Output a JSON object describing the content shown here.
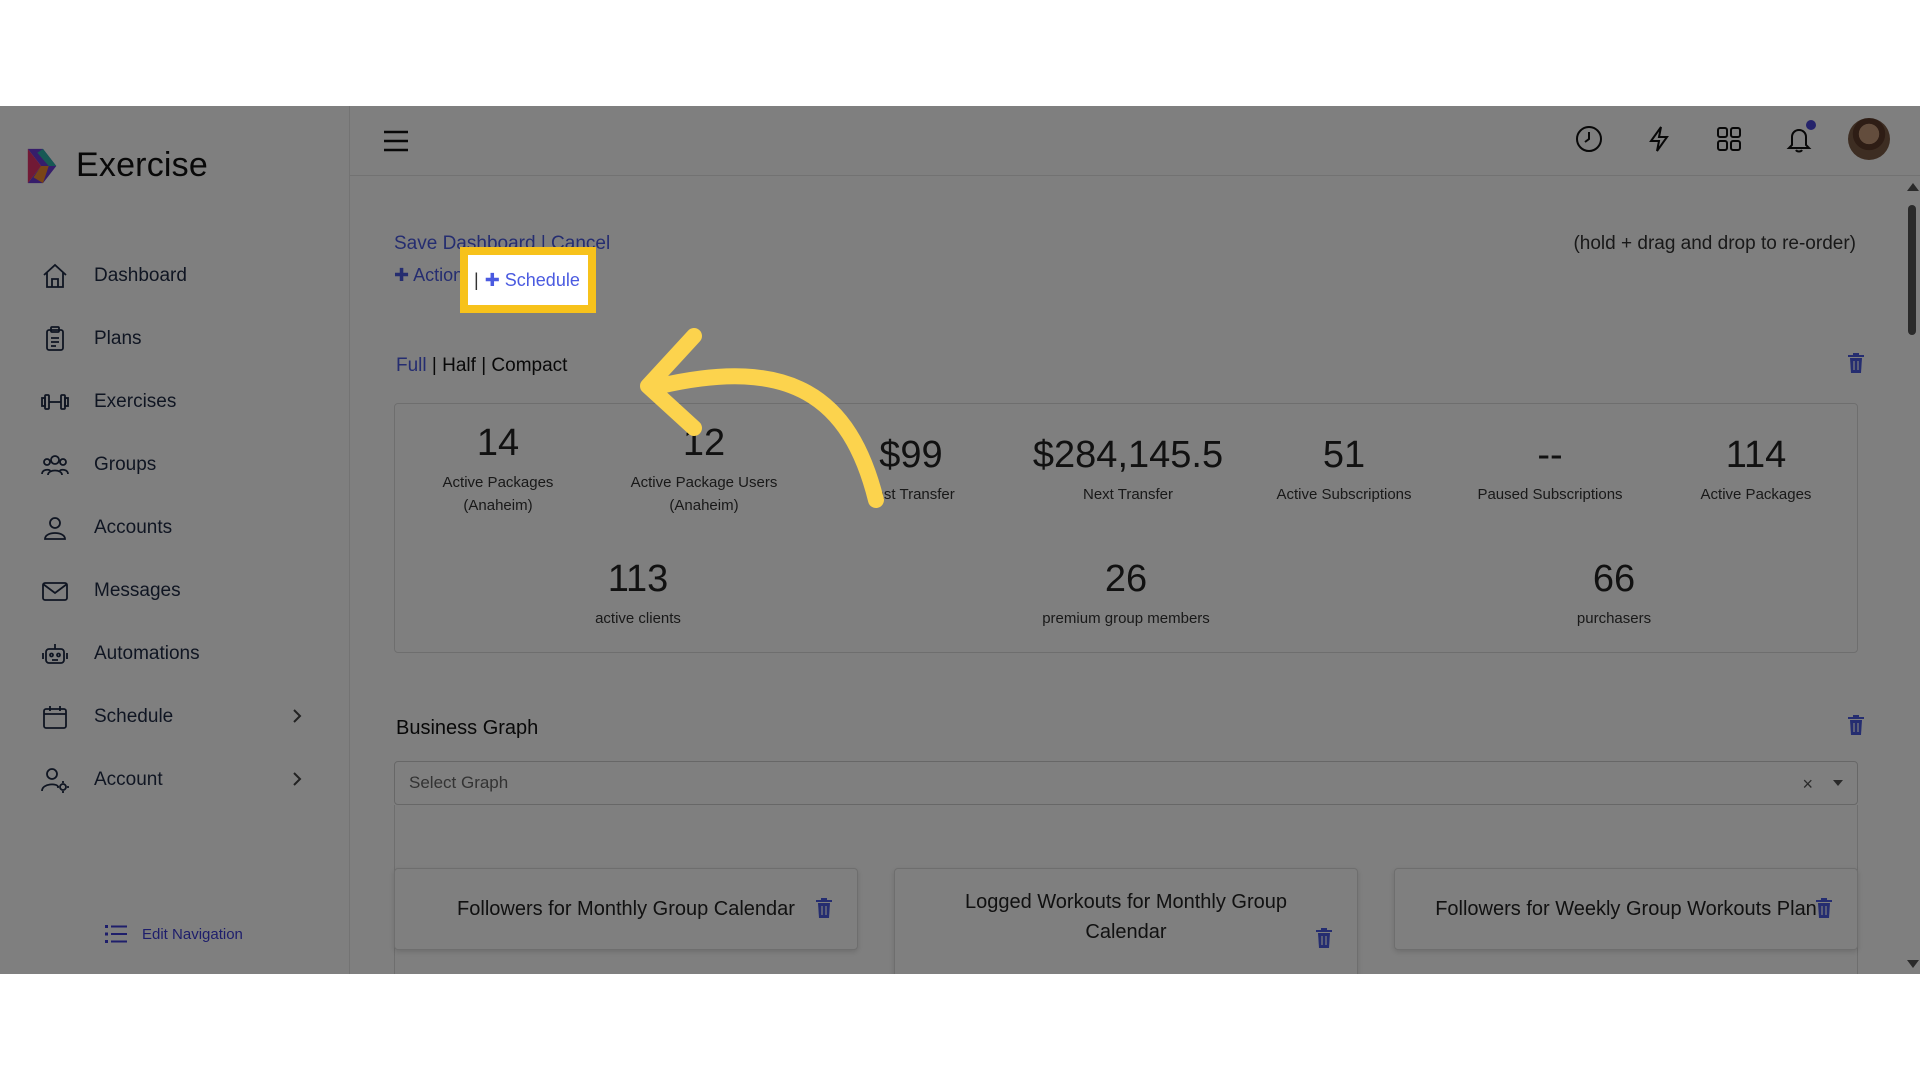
{
  "app": {
    "name": "Exercise"
  },
  "sidebar": {
    "items": [
      {
        "label": "Dashboard",
        "icon": "home-icon"
      },
      {
        "label": "Plans",
        "icon": "clipboard-icon"
      },
      {
        "label": "Exercises",
        "icon": "dumbbell-icon"
      },
      {
        "label": "Groups",
        "icon": "users-icon"
      },
      {
        "label": "Accounts",
        "icon": "user-icon"
      },
      {
        "label": "Messages",
        "icon": "mail-icon"
      },
      {
        "label": "Automations",
        "icon": "robot-icon"
      },
      {
        "label": "Schedule",
        "icon": "calendar-icon",
        "has_submenu": true
      },
      {
        "label": "Account",
        "icon": "user-gear-icon",
        "has_submenu": true
      }
    ],
    "edit_navigation": "Edit Navigation"
  },
  "dashboard": {
    "save_label": "Save Dashboard",
    "separator": "|",
    "cancel_label": "Cancel",
    "hint": "(hold + drag and drop to re-order)",
    "add_action": "Action",
    "add_schedule": "Schedule",
    "views": {
      "full": "Full",
      "half": "Half",
      "compact": "Compact",
      "separator": "|"
    }
  },
  "stats": [
    {
      "value": "14",
      "label": "Active Packages (Anaheim)"
    },
    {
      "value": "12",
      "label": "Active Package Users (Anaheim)"
    },
    {
      "value": "$99",
      "label": "Last Transfer"
    },
    {
      "value": "$284,145.5",
      "label": "Next Transfer"
    },
    {
      "value": "51",
      "label": "Active Subscriptions"
    },
    {
      "value": "--",
      "label": "Paused Subscriptions"
    },
    {
      "value": "114",
      "label": "Active Packages"
    },
    {
      "value": "113",
      "label": "active clients"
    },
    {
      "value": "26",
      "label": "premium group members"
    },
    {
      "value": "66",
      "label": "purchasers"
    }
  ],
  "business_graph": {
    "title": "Business Graph",
    "select_placeholder": "Select Graph",
    "clear_symbol": "×"
  },
  "graph_cards": [
    {
      "title": "Followers for Monthly Group Calendar"
    },
    {
      "title": "Logged Workouts for Monthly Group Calendar"
    },
    {
      "title": "Followers for Weekly Group Workouts Plan"
    }
  ],
  "colors": {
    "accent": "#4a5ae0",
    "highlight": "#f7c21b",
    "arrow": "#fcd34d",
    "notification": "#4b47d6"
  }
}
